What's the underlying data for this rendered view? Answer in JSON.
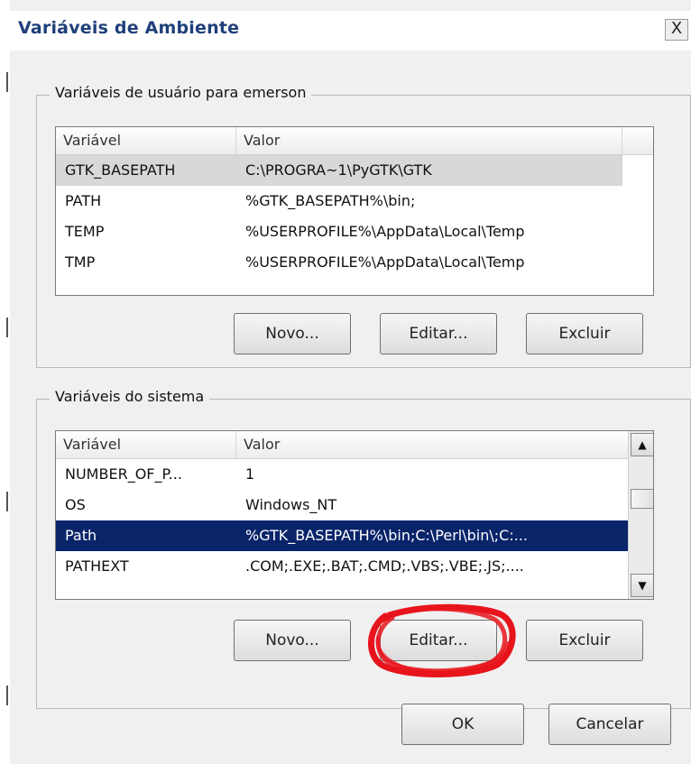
{
  "window": {
    "title": "Variáveis de Ambiente",
    "close_glyph": "X"
  },
  "user_vars": {
    "group_label": "Variáveis de usuário para emerson",
    "columns": [
      "Variável",
      "Valor"
    ],
    "rows": [
      {
        "name": "GTK_BASEPATH",
        "value": "C:\\PROGRA~1\\PyGTK\\GTK"
      },
      {
        "name": "PATH",
        "value": "%GTK_BASEPATH%\\bin;"
      },
      {
        "name": "TEMP",
        "value": "%USERPROFILE%\\AppData\\Local\\Temp"
      },
      {
        "name": "TMP",
        "value": "%USERPROFILE%\\AppData\\Local\\Temp"
      }
    ],
    "buttons": {
      "new": "Novo...",
      "edit": "Editar...",
      "delete": "Excluir"
    }
  },
  "system_vars": {
    "group_label": "Variáveis do sistema",
    "columns": [
      "Variável",
      "Valor"
    ],
    "rows": [
      {
        "name": "NUMBER_OF_P...",
        "value": "1"
      },
      {
        "name": "OS",
        "value": "Windows_NT"
      },
      {
        "name": "Path",
        "value": "%GTK_BASEPATH%\\bin;C:\\Perl\\bin\\;C:..."
      },
      {
        "name": "PATHEXT",
        "value": ".COM;.EXE;.BAT;.CMD;.VBS;.VBE;.JS;...."
      }
    ],
    "selected_index": 2,
    "buttons": {
      "new": "Novo...",
      "edit": "Editar...",
      "delete": "Excluir"
    },
    "scroll_up_glyph": "▲",
    "scroll_down_glyph": "▼"
  },
  "dialog_buttons": {
    "ok": "OK",
    "cancel": "Cancelar"
  },
  "colors": {
    "selection": "#0a246a",
    "annotation": "#e8141c"
  }
}
